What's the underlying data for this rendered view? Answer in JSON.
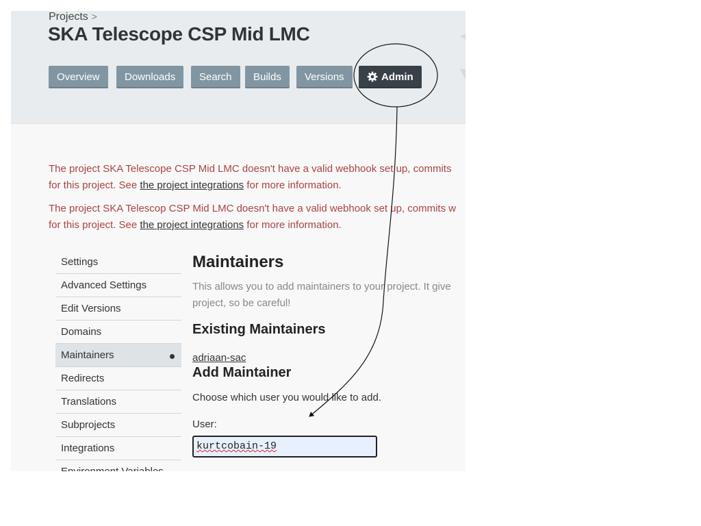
{
  "breadcrumb": {
    "root": "Projects",
    "sep": ">"
  },
  "project": {
    "title": "SKA Telescope CSP Mid LMC"
  },
  "tabs": [
    {
      "label": "Overview",
      "active": false
    },
    {
      "label": "Downloads",
      "active": false
    },
    {
      "label": "Search",
      "active": false
    },
    {
      "label": "Builds",
      "active": false
    },
    {
      "label": "Versions",
      "active": false
    },
    {
      "label": "Admin",
      "active": true,
      "icon": "gear-icon"
    }
  ],
  "warnings": [
    {
      "line1": "The project SKA Telescope CSP Mid LMC doesn't have a valid webhook set up, commits",
      "prefix": "for this project. See ",
      "link": "the project integrations",
      "suffix": " for more information."
    },
    {
      "line1": "The project SKA Telescop CSP Mid LMC doesn't have a valid webhook set up, commits w",
      "prefix": "for this project. See ",
      "link": "the project integrations",
      "suffix": " for more information."
    }
  ],
  "sidenav": [
    {
      "label": "Settings"
    },
    {
      "label": "Advanced Settings"
    },
    {
      "label": "Edit Versions"
    },
    {
      "label": "Domains"
    },
    {
      "label": "Maintainers",
      "active": true
    },
    {
      "label": "Redirects"
    },
    {
      "label": "Translations"
    },
    {
      "label": "Subprojects"
    },
    {
      "label": "Integrations"
    },
    {
      "label": "Environment Variables"
    }
  ],
  "main": {
    "heading": "Maintainers",
    "description_line1": "This allows you to add maintainers to your project. It give",
    "description_line2": "project, so be careful!",
    "existing_heading": "Existing Maintainers",
    "existing": [
      "adriaan-sac"
    ],
    "add_heading": "Add Maintainer",
    "add_prompt": "Choose which user you would like to add.",
    "user_label": "User:",
    "user_value": "kurtcobain-19"
  },
  "colors": {
    "warning_text": "#a94442",
    "tab_bg": "#8196a2",
    "tab_active_bg": "#384148",
    "header_bg": "#e9ecee",
    "input_bg": "#e8f0fe"
  }
}
